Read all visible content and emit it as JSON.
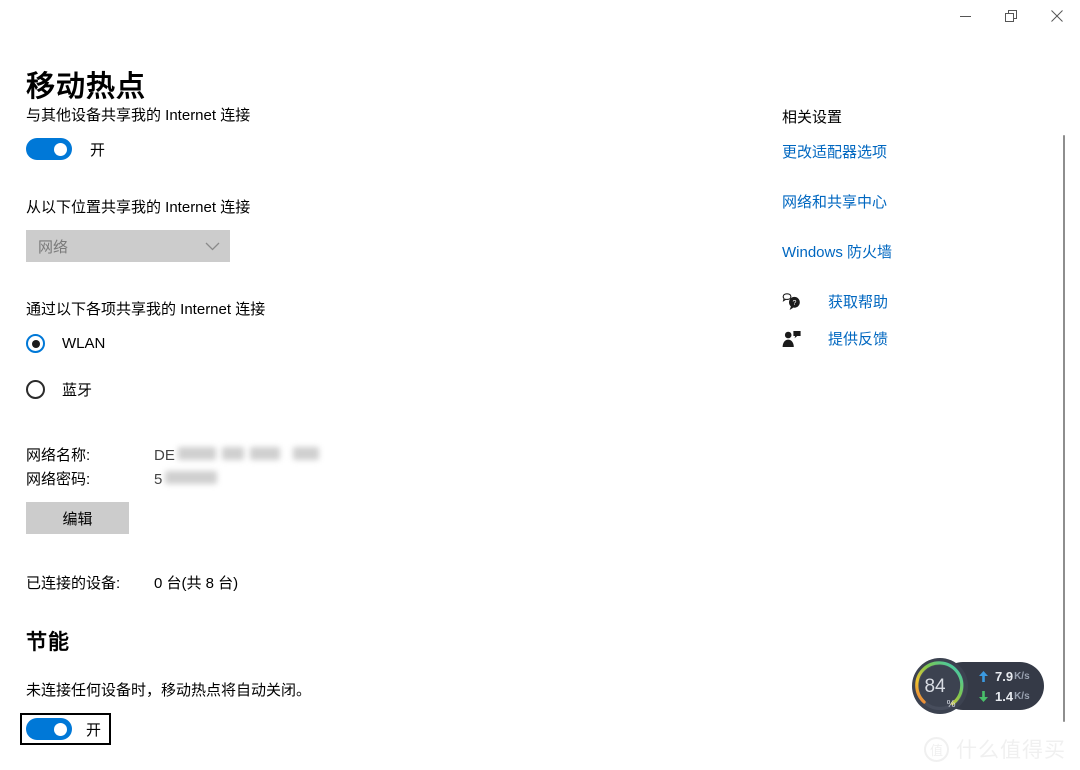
{
  "window": {
    "title": "移动热点",
    "caption_buttons": [
      {
        "name": "minimize",
        "label": "最小化"
      },
      {
        "name": "restore",
        "label": "还原"
      },
      {
        "name": "close",
        "label": "关闭"
      }
    ]
  },
  "main": {
    "share_label": "与其他设备共享我的 Internet 连接",
    "share_toggle": {
      "state": "开",
      "on": true
    },
    "share_from_label": "从以下位置共享我的 Internet 连接",
    "share_from_value": "网络",
    "share_via_label": "通过以下各项共享我的 Internet 连接",
    "radios": [
      {
        "label": "WLAN",
        "selected": true
      },
      {
        "label": "蓝牙",
        "selected": false
      }
    ],
    "network_name_key": "网络名称:",
    "network_name_value": "DE",
    "network_password_key": "网络密码:",
    "network_password_value": "5",
    "edit_button": "编辑",
    "connected_key": "已连接的设备:",
    "connected_value": "0 台(共 8 台)",
    "power_heading": "节能",
    "power_description": "未连接任何设备时，移动热点将自动关闭。",
    "power_toggle": {
      "state": "开",
      "on": true,
      "focused": true
    }
  },
  "sidebar": {
    "heading": "相关设置",
    "links": [
      "更改适配器选项",
      "网络和共享中心",
      "Windows 防火墙"
    ],
    "support": [
      {
        "icon": "help-icon",
        "label": "获取帮助"
      },
      {
        "icon": "feedback-icon",
        "label": "提供反馈"
      }
    ]
  },
  "netmon": {
    "percent": "84",
    "percent_sign": "%",
    "upload": {
      "value": "7.9",
      "unit": "K/s",
      "direction": "up"
    },
    "download": {
      "value": "1.4",
      "unit": "K/s",
      "direction": "down"
    }
  },
  "watermark": {
    "badge": "值",
    "text": "什么值得买"
  },
  "colors": {
    "accent": "#0078d7",
    "link": "#0067c0",
    "disabled_bg": "#cccccc",
    "upload_arrow": "#3b9ae1",
    "download_arrow": "#49c06a"
  }
}
